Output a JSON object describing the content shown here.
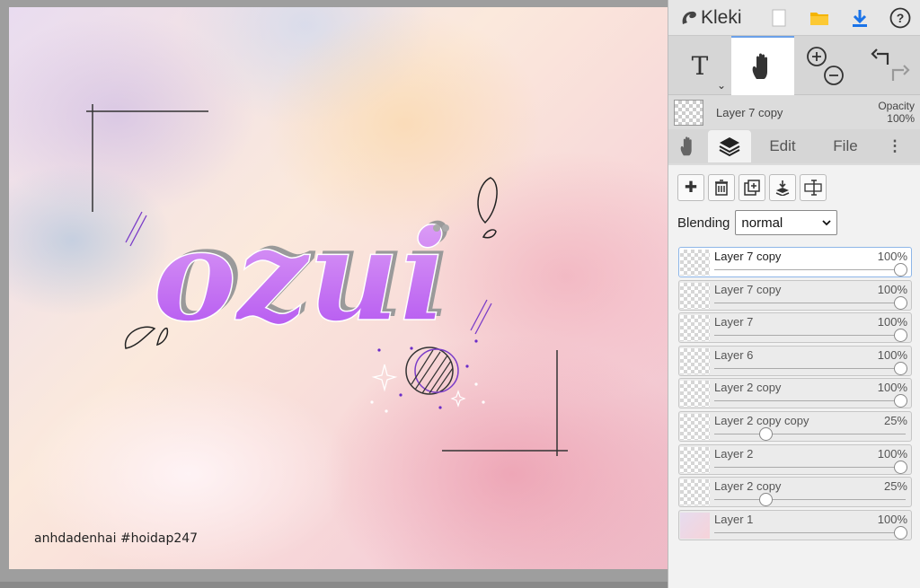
{
  "app": {
    "name": "Kleki"
  },
  "canvas": {
    "watermark": "anhdadenhai #hoidap247",
    "artwork_text": "ozui"
  },
  "toolbar": {
    "icons": [
      "new-image-icon",
      "open-folder-icon",
      "download-icon",
      "help-icon"
    ],
    "tools": [
      {
        "name": "text-tool",
        "label": "T",
        "active": false
      },
      {
        "name": "hand-tool",
        "active": true
      }
    ]
  },
  "current_layer": {
    "name": "Layer 7 copy",
    "opacity_label": "Opacity",
    "opacity_value": "100%"
  },
  "tabs": [
    {
      "name": "hand-tab",
      "label": ""
    },
    {
      "name": "layers-tab",
      "label": "",
      "active": true
    },
    {
      "name": "edit-tab",
      "label": "Edit"
    },
    {
      "name": "file-tab",
      "label": "File"
    }
  ],
  "layer_actions": [
    "add-layer-icon",
    "delete-layer-icon",
    "duplicate-layer-icon",
    "merge-down-icon",
    "rename-layer-icon"
  ],
  "blending": {
    "label": "Blending",
    "value": "normal"
  },
  "layers": [
    {
      "name": "Layer 7 copy",
      "opacity": "100%",
      "fraction": 1.0,
      "selected": true
    },
    {
      "name": "Layer 7 copy",
      "opacity": "100%",
      "fraction": 1.0
    },
    {
      "name": "Layer 7",
      "opacity": "100%",
      "fraction": 1.0
    },
    {
      "name": "Layer 6",
      "opacity": "100%",
      "fraction": 1.0
    },
    {
      "name": "Layer 2 copy",
      "opacity": "100%",
      "fraction": 1.0
    },
    {
      "name": "Layer 2 copy copy",
      "opacity": "25%",
      "fraction": 0.25
    },
    {
      "name": "Layer 2",
      "opacity": "100%",
      "fraction": 1.0
    },
    {
      "name": "Layer 2 copy",
      "opacity": "25%",
      "fraction": 0.25
    },
    {
      "name": "Layer 1",
      "opacity": "100%",
      "fraction": 1.0
    }
  ],
  "colors": {
    "accent": "#6aa0e8",
    "download": "#1a73e8",
    "folder": "#f4b400",
    "letters": "#c46cf0"
  }
}
